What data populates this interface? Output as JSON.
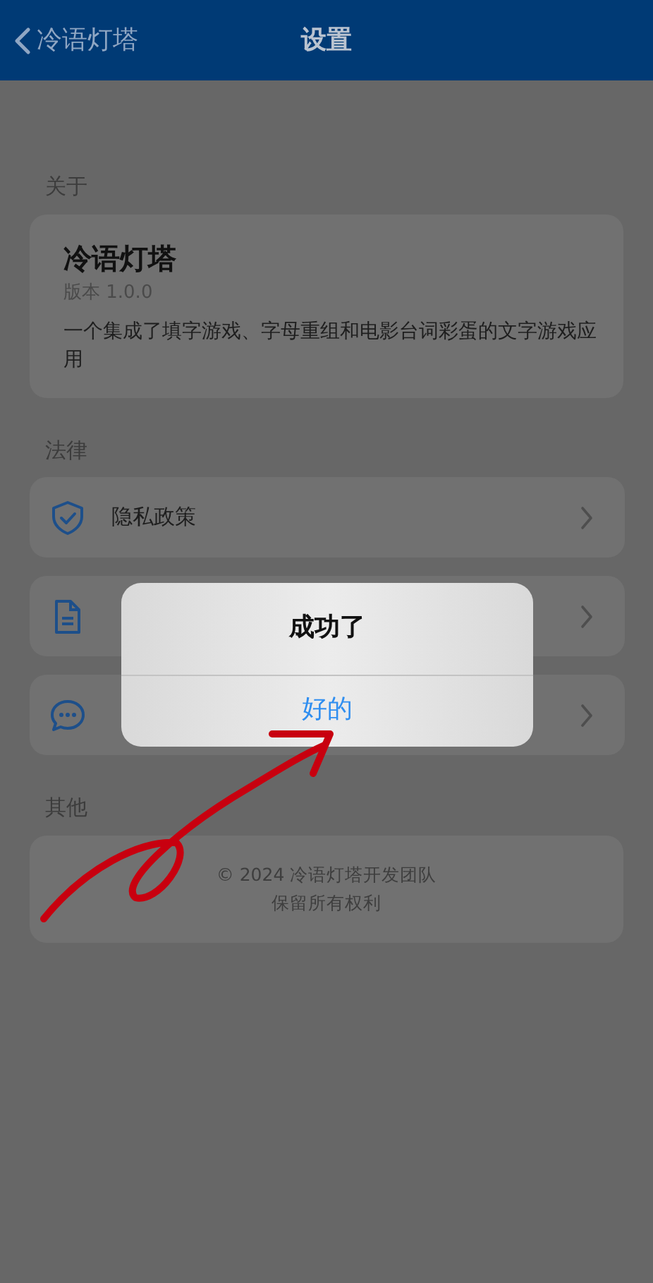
{
  "nav": {
    "back_label": "冷语灯塔",
    "title": "设置"
  },
  "sections": [
    {
      "kind": "about",
      "heading": "关于",
      "title": "冷语灯塔",
      "version": "版本 1.0.0",
      "description": "一个集成了填字游戏、字母重组和电影台词彩蛋的文字游戏应用"
    },
    {
      "kind": "links",
      "heading": "法律",
      "items": [
        {
          "kind": "text",
          "label": "隐私政策"
        },
        {
          "kind": "covered"
        },
        {
          "kind": "covered"
        }
      ]
    },
    {
      "kind": "footer",
      "heading": "其他",
      "lines": [
        "© 2024 冷语灯塔开发团队",
        "保留所有权利"
      ]
    }
  ],
  "dialog": {
    "title": "成功了",
    "button": "好的"
  }
}
